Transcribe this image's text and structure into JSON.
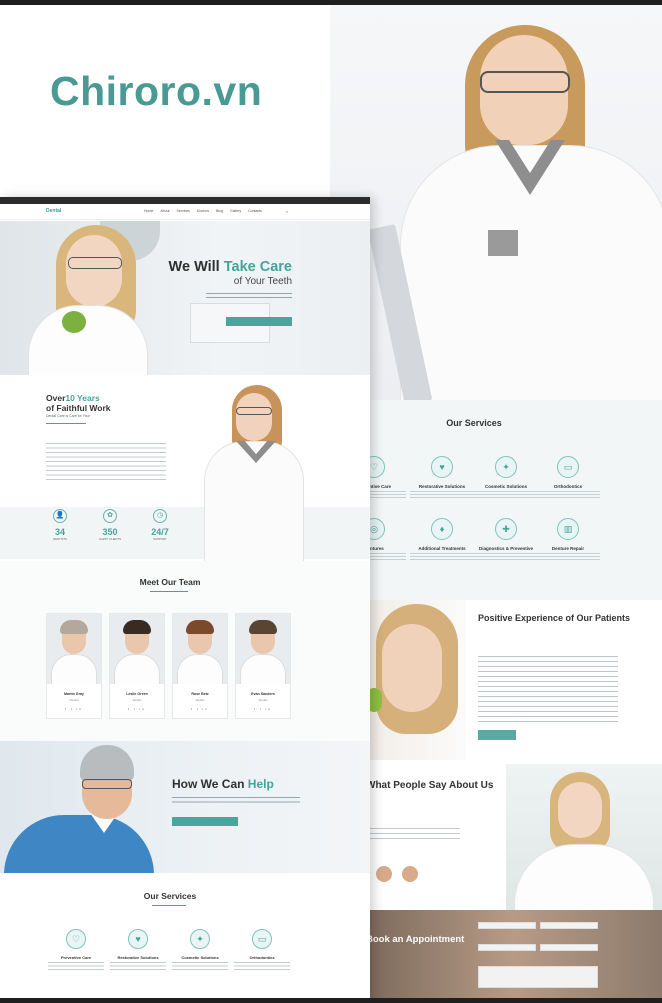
{
  "watermark": "Chiroro.vn",
  "site": {
    "logo": "Dental",
    "menu": [
      "Home",
      "About",
      "Services",
      "Doctors",
      "Blog",
      "Gallery",
      "Contacts"
    ],
    "hero": {
      "title_a": "We Will ",
      "title_b": "Take Care",
      "subtitle": "of Your Teeth",
      "button": "MAKE AN APPOINTMENT"
    },
    "about": {
      "over": "Over",
      "years": "10 Years",
      "line2": "of Faithful Work",
      "tagline": "Dental Care is Care for Your"
    },
    "stats": [
      {
        "icon": "person-icon",
        "glyph": "👤",
        "value": "34",
        "label": "DENTISTS"
      },
      {
        "icon": "tooth-icon",
        "glyph": "✿",
        "value": "350",
        "label": "HAPPY CLIENTS"
      },
      {
        "icon": "clock-icon",
        "glyph": "◷",
        "value": "24/7",
        "label": "SUPPORT"
      }
    ],
    "team": {
      "title": "Meet Our Team",
      "members": [
        {
          "name": "Martin Gray",
          "role": "Dentist",
          "hair": "#b3a89a"
        },
        {
          "name": "Leslie Green",
          "role": "Dentist",
          "hair": "#3a2b22"
        },
        {
          "name": "Rose Betz",
          "role": "Dentist",
          "hair": "#7a4a2a"
        },
        {
          "name": "Evan Sanders",
          "role": "Dentist",
          "hair": "#5a4535"
        }
      ],
      "social": "f t in"
    },
    "help": {
      "title_a": "How We Can ",
      "title_b": "Help",
      "button": "MAKE AN APPOINTMENT"
    },
    "services": {
      "title": "Our Services",
      "items": [
        {
          "name": "Preventive Care",
          "glyph": "♡"
        },
        {
          "name": "Restorative Solutions",
          "glyph": "♥"
        },
        {
          "name": "Cosmetic Solutions",
          "glyph": "✦"
        },
        {
          "name": "Orthodontics",
          "glyph": "▭"
        }
      ]
    }
  },
  "back_sheet": {
    "services_title": "Our Services",
    "services": [
      {
        "name": "Preventive Care",
        "glyph": "♡"
      },
      {
        "name": "Restorative Solutions",
        "glyph": "♥"
      },
      {
        "name": "Cosmetic Solutions",
        "glyph": "✦"
      },
      {
        "name": "Orthodontics",
        "glyph": "▭"
      },
      {
        "name": "Dentures",
        "glyph": "◎"
      },
      {
        "name": "Additional Treatments",
        "glyph": "♦"
      },
      {
        "name": "Diagnostics & Preventive",
        "glyph": "✚"
      },
      {
        "name": "Denture Repair",
        "glyph": "▥"
      }
    ],
    "positive_title": "Positive Experience of Our Patients",
    "people_title": "What People Say About Us",
    "appointment_title": "Book an Appointment"
  },
  "colors": {
    "accent": "#46a39a",
    "brand_watermark": "#4a9a94"
  }
}
